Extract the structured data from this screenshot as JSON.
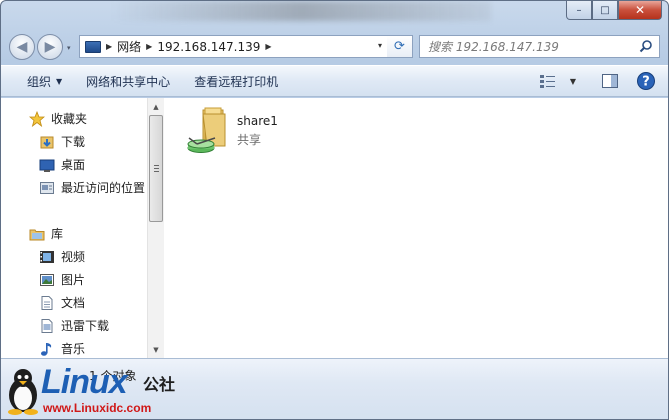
{
  "window": {
    "minimize_glyph": "–",
    "maximize_glyph": "□",
    "close_glyph": "✕"
  },
  "nav": {
    "back_glyph": "◀",
    "forward_glyph": "▶",
    "dropdown_glyph": "▾"
  },
  "address": {
    "crumbs": [
      "网络",
      "192.168.147.139"
    ],
    "separator": "▶",
    "dropdown_glyph": "▾",
    "refresh_glyph": "⟳"
  },
  "search": {
    "placeholder": "搜索 192.168.147.139"
  },
  "toolbar": {
    "organize_label": "组织",
    "organize_arrow": "▼",
    "network_center_label": "网络和共享中心",
    "remote_printers_label": "查看远程打印机",
    "view_arrow": "▼"
  },
  "sidebar": {
    "favorites_header": "收藏夹",
    "favorites": [
      {
        "label": "下载",
        "icon": "downloads-folder-icon"
      },
      {
        "label": "桌面",
        "icon": "desktop-icon"
      },
      {
        "label": "最近访问的位置",
        "icon": "recent-places-icon"
      }
    ],
    "libraries_header": "库",
    "libraries": [
      {
        "label": "视频",
        "icon": "video-icon"
      },
      {
        "label": "图片",
        "icon": "pictures-icon"
      },
      {
        "label": "文档",
        "icon": "documents-icon"
      },
      {
        "label": "迅雷下载",
        "icon": "xunlei-download-icon"
      },
      {
        "label": "音乐",
        "icon": "music-icon"
      }
    ]
  },
  "scrollbar": {
    "up_glyph": "▲",
    "down_glyph": "▼"
  },
  "content": {
    "items": [
      {
        "name": "share1",
        "type": "共享",
        "icon": "shared-folder-icon"
      }
    ]
  },
  "status": {
    "text": "1 个对象"
  },
  "watermark": {
    "logo": "Linux",
    "cn": "公社",
    "url": "www.Linuxidc.com"
  },
  "colors": {
    "accent": "#1d5fb4",
    "close_button": "#c9503c",
    "watermark_url": "#d01818"
  }
}
